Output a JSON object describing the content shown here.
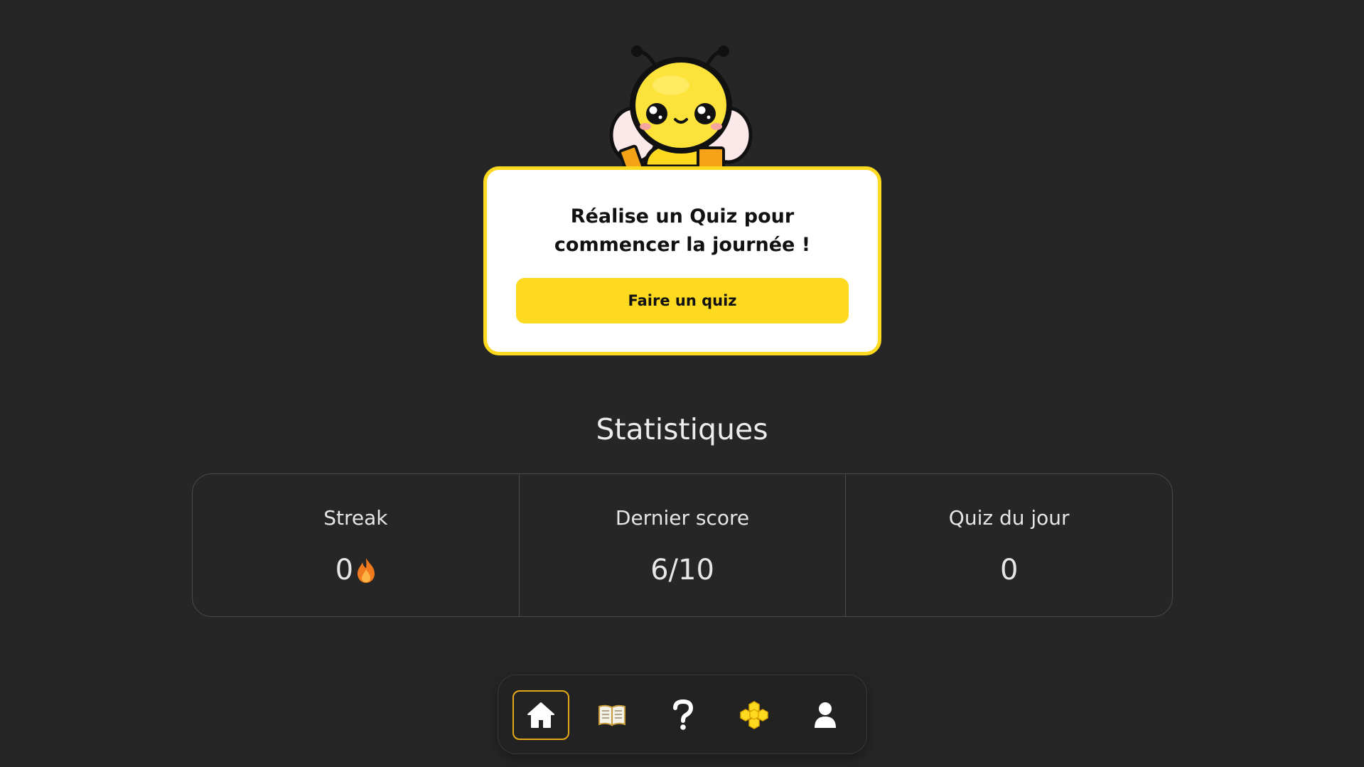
{
  "prompt": {
    "message": "Réalise un Quiz pour commencer la journée !",
    "button_label": "Faire un quiz"
  },
  "stats": {
    "title": "Statistiques",
    "items": [
      {
        "label": "Streak",
        "value": "0"
      },
      {
        "label": "Dernier score",
        "value": "6/10"
      },
      {
        "label": "Quiz du jour",
        "value": "0"
      }
    ]
  },
  "nav": {
    "items": [
      {
        "icon": "home-icon",
        "active": true
      },
      {
        "icon": "book-icon",
        "active": false
      },
      {
        "icon": "question-icon",
        "active": false
      },
      {
        "icon": "honeycomb-icon",
        "active": false
      },
      {
        "icon": "user-icon",
        "active": false
      }
    ]
  },
  "colors": {
    "background": "#262626",
    "accent": "#fdd91f",
    "active_border": "#e3a918",
    "card": "#ffffff",
    "panel_border": "#4a4a4a"
  }
}
